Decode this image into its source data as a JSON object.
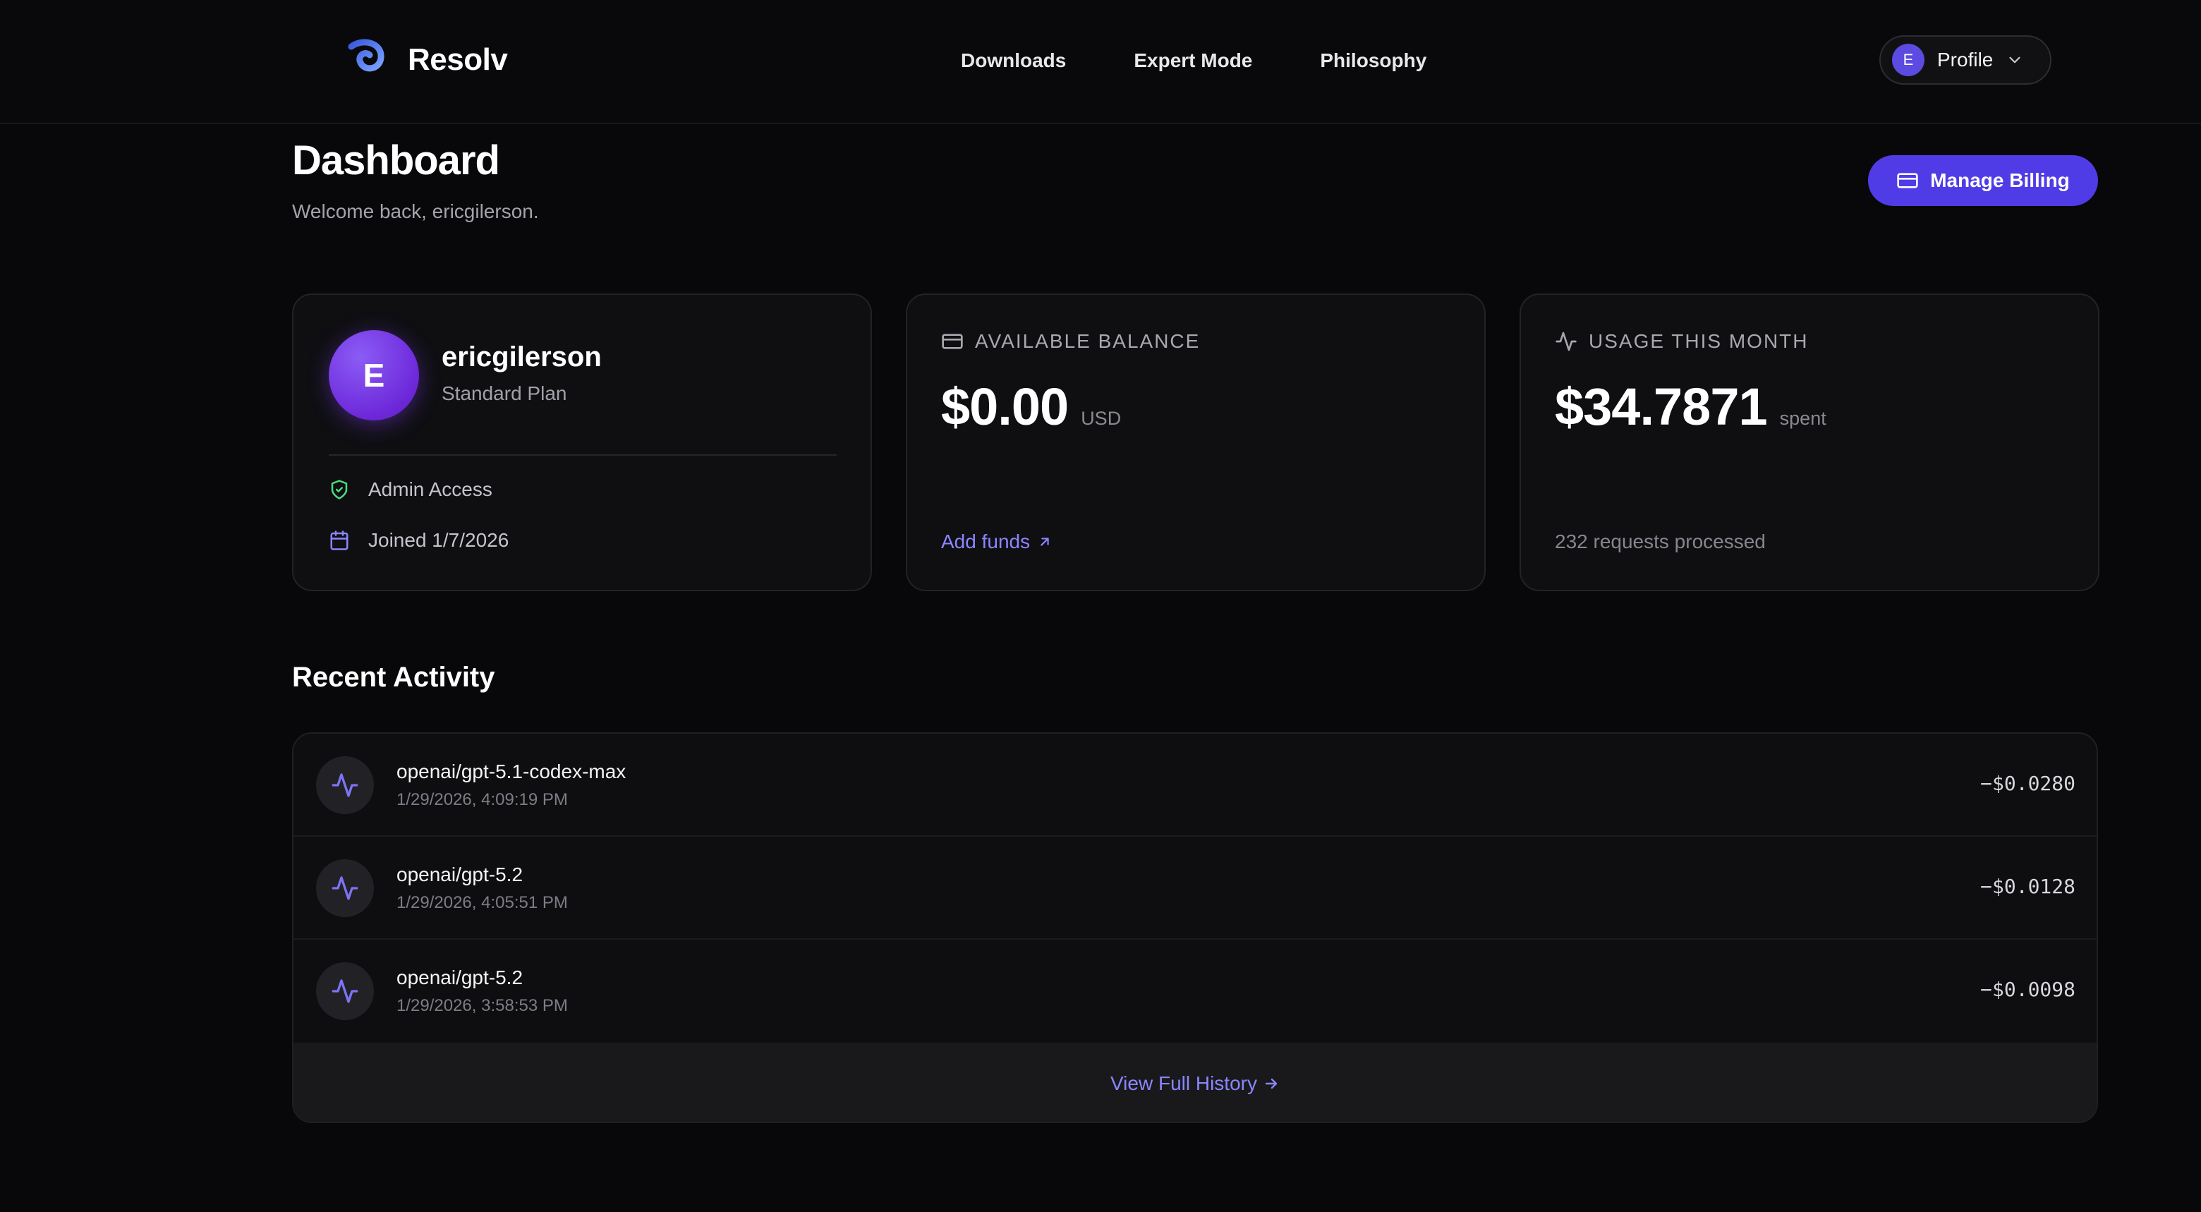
{
  "header": {
    "brand": "Resolv",
    "nav": [
      "Downloads",
      "Expert Mode",
      "Philosophy"
    ],
    "profile": {
      "initial": "E",
      "label": "Profile"
    }
  },
  "page": {
    "title": "Dashboard",
    "welcome": "Welcome back, ericgilerson.",
    "billing_button": "Manage Billing"
  },
  "account_card": {
    "initial": "E",
    "username": "ericgilerson",
    "plan": "Standard Plan",
    "access": "Admin Access",
    "joined": "Joined 1/7/2026"
  },
  "balance_card": {
    "heading": "AVAILABLE BALANCE",
    "amount": "$0.00",
    "unit": "USD",
    "link": "Add funds"
  },
  "usage_card": {
    "heading": "USAGE THIS MONTH",
    "amount": "$34.7871",
    "unit": "spent",
    "requests": "232 requests processed"
  },
  "activity": {
    "title": "Recent Activity",
    "items": [
      {
        "model": "openai/gpt-5.1-codex-max",
        "time": "1/29/2026, 4:09:19 PM",
        "amount": "−$0.0280"
      },
      {
        "model": "openai/gpt-5.2",
        "time": "1/29/2026, 4:05:51 PM",
        "amount": "−$0.0128"
      },
      {
        "model": "openai/gpt-5.2",
        "time": "1/29/2026, 3:58:53 PM",
        "amount": "−$0.0098"
      }
    ],
    "history_link": "View Full History"
  },
  "colors": {
    "accent": "#4f3ce6",
    "link": "#8b85ff",
    "background": "#08080a",
    "card": "#0f0f12",
    "shield": "#4ade80"
  },
  "icons": [
    "resolv-logo-icon",
    "chevron-down-icon",
    "credit-card-icon",
    "shield-check-icon",
    "calendar-icon",
    "activity-icon",
    "arrow-up-right-icon",
    "arrow-right-icon"
  ]
}
